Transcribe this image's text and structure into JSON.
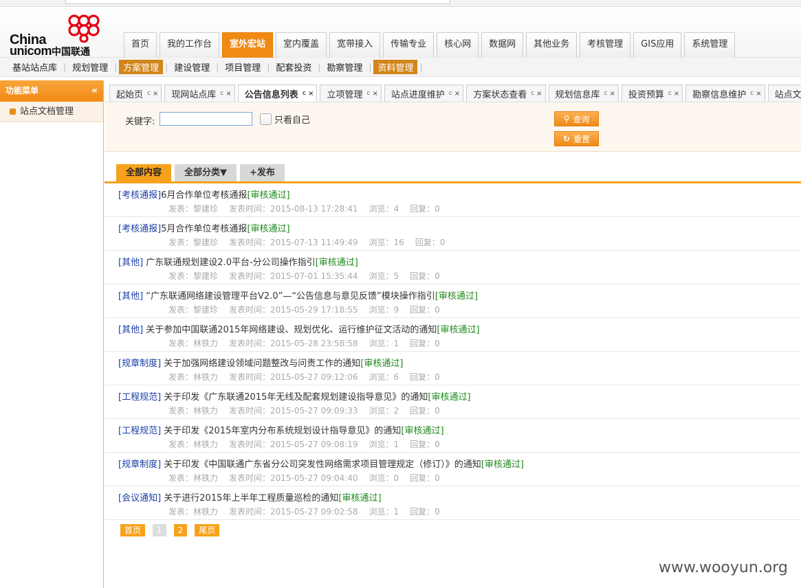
{
  "logo": {
    "line1": "China",
    "line2": "unicom",
    "cn": "中国联通"
  },
  "main_nav": [
    "首页",
    "我的工作台",
    "室外宏站",
    "室内覆盖",
    "宽带接入",
    "传输专业",
    "核心网",
    "数据网",
    "其他业务",
    "考核管理",
    "GIS应用",
    "系统管理"
  ],
  "main_nav_active": 2,
  "sub_nav": [
    "基站站点库",
    "规划管理",
    "方案管理",
    "建设管理",
    "项目管理",
    "配套投资",
    "勘察管理",
    "资料管理"
  ],
  "sub_nav_active": [
    2,
    7
  ],
  "left_panel": {
    "title": "功能菜单",
    "items": [
      "站点文档管理"
    ]
  },
  "tabs": [
    "起始页",
    "现网站点库",
    "公告信息列表",
    "立项管理",
    "站点进度维护",
    "方案状态查看",
    "规划信息库",
    "投资预算",
    "勘察信息维护",
    "站点文档管理"
  ],
  "tabs_active": 2,
  "search": {
    "keyword_label": "关键字:",
    "keyword_value": "",
    "only_me_label": "只看自己",
    "query_label": "查询",
    "reset_label": "重置"
  },
  "list_tabs": [
    "全部内容",
    "全部分类▼",
    "+发布"
  ],
  "posts": [
    {
      "category": "[考核通报]",
      "title": "6月合作单位考核通报",
      "status": "[审核通过]",
      "author": "发表：黎建珍",
      "time": "发表时间：2015-08-13 17:28:41",
      "views": "浏览：4",
      "replies": "回复：0"
    },
    {
      "category": "[考核通报]",
      "title": "5月合作单位考核通报",
      "status": "[审核通过]",
      "author": "发表：黎建珍",
      "time": "发表时间：2015-07-13 11:49:49",
      "views": "浏览：16",
      "replies": "回复：0"
    },
    {
      "category": "[其他]",
      "title": " 广东联通规划建设2.0平台-分公司操作指引",
      "status": "[审核通过]",
      "author": "发表：黎建珍",
      "time": "发表时间：2015-07-01 15:35:44",
      "views": "浏览：5",
      "replies": "回复：0"
    },
    {
      "category": "[其他]",
      "title": " “广东联通网络建设管理平台V2.0”—“公告信息与意见反馈”模块操作指引",
      "status": "[审核通过]",
      "author": "发表：黎建珍",
      "time": "发表时间：2015-05-29 17:18:55",
      "views": "浏览：9",
      "replies": "回复：0"
    },
    {
      "category": "[其他]",
      "title": " 关于参加中国联通2015年网络建设、规划优化、运行维护征文活动的通知",
      "status": "[审核通过]",
      "author": "发表：林铁力",
      "time": "发表时间：2015-05-28 23:58:58",
      "views": "浏览：1",
      "replies": "回复：0"
    },
    {
      "category": "[规章制度]",
      "title": " 关于加强网络建设领域问题整改与问责工作的通知",
      "status": "[审核通过]",
      "author": "发表：林铁力",
      "time": "发表时间：2015-05-27 09:12:06",
      "views": "浏览：6",
      "replies": "回复：0"
    },
    {
      "category": "[工程规范]",
      "title": " 关于印发《广东联通2015年无线及配套规划建设指导意见》的通知",
      "status": "[审核通过]",
      "author": "发表：林铁力",
      "time": "发表时间：2015-05-27 09:09:33",
      "views": "浏览：2",
      "replies": "回复：0"
    },
    {
      "category": "[工程规范]",
      "title": " 关于印发《2015年室内分布系统规划设计指导意见》的通知",
      "status": "[审核通过]",
      "author": "发表：林铁力",
      "time": "发表时间：2015-05-27 09:08:19",
      "views": "浏览：1",
      "replies": "回复：0"
    },
    {
      "category": "[规章制度]",
      "title": " 关于印发《中国联通广东省分公司突发性网络需求项目管理规定（修订）》的通知",
      "status": "[审核通过]",
      "author": "发表：林铁力",
      "time": "发表时间：2015-05-27 09:04:40",
      "views": "浏览：0",
      "replies": "回复：0"
    },
    {
      "category": "[会议通知]",
      "title": " 关于进行2015年上半年工程质量巡检的通知",
      "status": "[审核通过]",
      "author": "发表：林铁力",
      "time": "发表时间：2015-05-27 09:02:58",
      "views": "浏览：1",
      "replies": "回复：0"
    }
  ],
  "pager": {
    "first": "首页",
    "p1": "1",
    "p2": "2",
    "last": "尾页"
  },
  "watermark": "www.wooyun.org",
  "colors": {
    "accent": "#f08a14",
    "category": "#1a3ea8",
    "status": "#1e8a1e"
  }
}
